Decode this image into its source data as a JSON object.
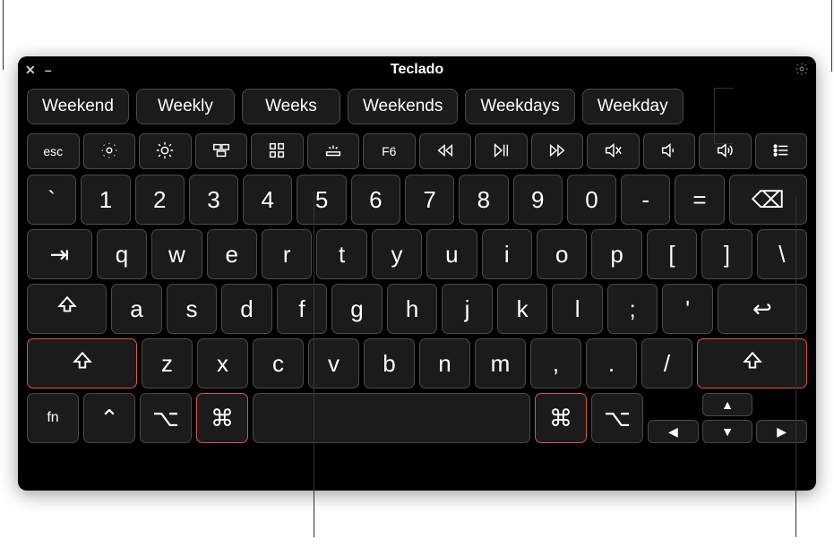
{
  "window": {
    "title": "Teclado"
  },
  "suggestions": [
    "Weekend",
    "Weekly",
    "Weeks",
    "Weekends",
    "Weekdays",
    "Weekday"
  ],
  "fnRow": {
    "esc": "esc",
    "f6": "F6",
    "icons": {
      "brightnessDown": "brightness-down",
      "brightnessUp": "brightness-up",
      "missionControl": "mission-control",
      "launchpad": "launchpad",
      "keyboardBrightness": "keyboard-brightness",
      "rewind": "rewind",
      "playPause": "play-pause",
      "forward": "forward",
      "mute": "mute",
      "volumeDown": "volume-down",
      "volumeUp": "volume-up",
      "list": "list-menu"
    }
  },
  "rows": {
    "num": [
      "`",
      "1",
      "2",
      "3",
      "4",
      "5",
      "6",
      "7",
      "8",
      "9",
      "0",
      "-",
      "="
    ],
    "qwerty": [
      "q",
      "w",
      "e",
      "r",
      "t",
      "y",
      "u",
      "i",
      "o",
      "p",
      "[",
      "]",
      "\\"
    ],
    "asdf": [
      "a",
      "s",
      "d",
      "f",
      "g",
      "h",
      "j",
      "k",
      "l",
      ";",
      "'"
    ],
    "zxcv": [
      "z",
      "x",
      "c",
      "v",
      "b",
      "n",
      "m",
      ",",
      ".",
      "/"
    ]
  },
  "mods": {
    "fn": "fn",
    "ctrl": "⌃",
    "opt": "⌥",
    "cmd": "⌘",
    "shift": "⇧",
    "caps": "⇪",
    "tab": "⇥",
    "return": "↩",
    "backspace": "⌫"
  },
  "arrows": {
    "up": "▲",
    "down": "▼",
    "left": "◀",
    "right": "▶"
  }
}
